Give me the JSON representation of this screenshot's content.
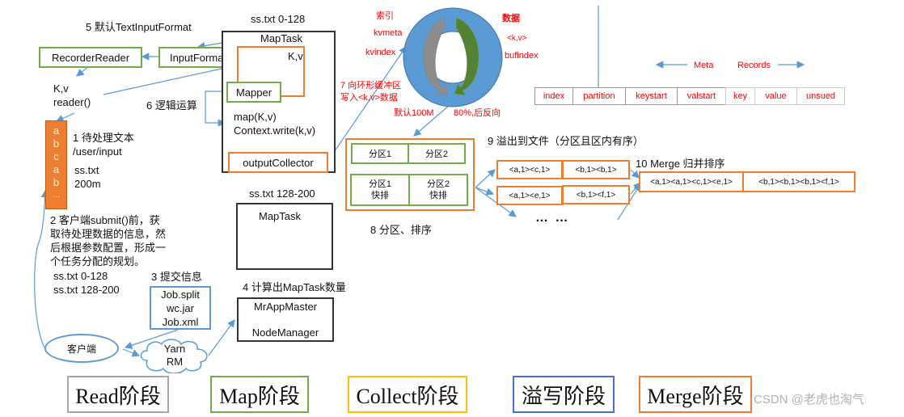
{
  "watermark": "CSDN @老虎也淘气",
  "read_side": {
    "step5_label": "5 默认TextInputFormat",
    "recorder_reader": "RecorderReader",
    "input_format": "InputFormat",
    "kv": "K,v",
    "reader_call": "reader()",
    "file_chars": [
      "a",
      "b",
      "c",
      "a",
      "b",
      "…"
    ],
    "step1_label": "1 待处理文本",
    "input_path": "/user/input",
    "file_name": "ss.txt",
    "file_size": "200m",
    "step2_lines": [
      "2 客户端submit()前，获",
      "取待处理数据的信息，然",
      "后根据参数配置，形成一",
      "个任务分配的规划。"
    ],
    "splits": [
      "ss.txt  0-128",
      "ss.txt  128-200"
    ],
    "step3_label": "3 提交信息",
    "job_files": [
      "Job.split",
      "wc.jar",
      "Job.xml"
    ],
    "client": "客户端",
    "yarn": [
      "Yarn",
      "RM"
    ],
    "step4_label": "4 计算出MapTask数量",
    "app_master": [
      "MrAppMaster",
      "NodeManager"
    ]
  },
  "maptask1": {
    "caption": "ss.txt 0-128",
    "title": "MapTask",
    "kv": "K,v",
    "mapper": "Mapper",
    "map_call": "map(K,v)",
    "context_write": "Context.write(k,v)",
    "output_collector": "outputCollector",
    "step6_label": "6 逻辑运算"
  },
  "maptask2": {
    "caption": "ss.txt 128-200",
    "title": "MapTask"
  },
  "ring_buffer": {
    "index_label": "索引",
    "kvmeta": "kvmeta",
    "kvindex": "kvindex",
    "data_label": "数据",
    "kv_type": "<k,v>",
    "bufindex": "bufindex",
    "step7_lines": [
      "7 向环形缓冲区",
      "写入<k,v>数据"
    ],
    "default_size": "默认100M",
    "threshold": "80%,后反向",
    "colors": {
      "ring": "#5b9bd5",
      "meta_arrow": "#8c8c8c",
      "data_arrow": "#548235"
    }
  },
  "meta_records": {
    "meta_label": "Meta",
    "records_label": "Records",
    "cells": [
      "index",
      "partition",
      "keystart",
      "valstart",
      "key",
      "value",
      "unsued"
    ]
  },
  "partition": {
    "row1": [
      "分区1",
      "分区2"
    ],
    "row2": [
      [
        "分区1",
        "快排"
      ],
      [
        "分区2",
        "快排"
      ]
    ],
    "step8_label": "8 分区、排序"
  },
  "spill": {
    "step9_label": "9 溢出到文件（分区且区内有序）",
    "rows": [
      [
        "<a,1><c,1>",
        "<b,1><b,1>"
      ],
      [
        "<a,1><e,1>",
        "<b,1><f,1>"
      ]
    ],
    "ellipsis": "… …"
  },
  "merge": {
    "step10_label": "10 Merge 归并排序",
    "cells": [
      "<a,1><a,1><c,1><e,1>",
      "<b,1><b,1><b,1><f,1>"
    ]
  },
  "phases": [
    {
      "label": "Read阶段",
      "color": "#a6a6a6"
    },
    {
      "label": "Map阶段",
      "color": "#70ad47"
    },
    {
      "label": "Collect阶段",
      "color": "#ffc000"
    },
    {
      "label": "溢写阶段",
      "color": "#4472c4"
    },
    {
      "label": "Merge阶段",
      "color": "#ed7d31"
    }
  ]
}
